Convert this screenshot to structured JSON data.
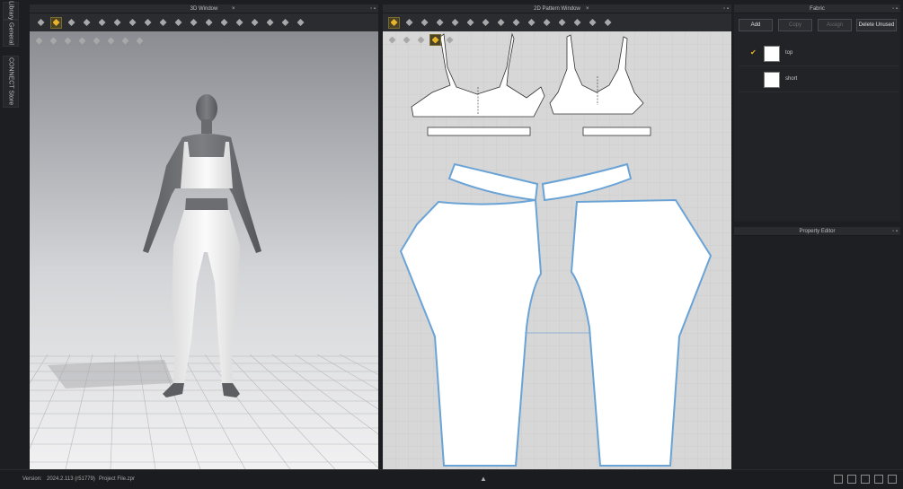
{
  "side_tabs": {
    "library": "Library",
    "general": "General",
    "connect": "CONNECT Store"
  },
  "window_3d": {
    "title": "3D Window",
    "btn_min": "–",
    "btn_close": "×"
  },
  "window_2d": {
    "title": "2D Pattern Window",
    "btn_min": "–",
    "btn_close": "×"
  },
  "fabric_panel": {
    "title": "Fabric",
    "buttons": {
      "add": "Add",
      "copy": "Copy",
      "assign": "Assign",
      "delete_unused": "Delete Unused"
    },
    "items": [
      {
        "name": "top",
        "checked": true,
        "color": "#ffffff"
      },
      {
        "name": "short",
        "checked": false,
        "color": "#ffffff"
      }
    ]
  },
  "property_editor": {
    "title": "Property Editor"
  },
  "status": {
    "version_label": "Version:",
    "version_value": "2024.2.113 (r51779)",
    "project_file": "Project File.zpr"
  },
  "colors": {
    "accent": "#e8b52a",
    "pattern_outline": "#6aa3d6",
    "pattern_bg": "#d7d7d7",
    "viewport_bg": "#9a9a9f"
  }
}
